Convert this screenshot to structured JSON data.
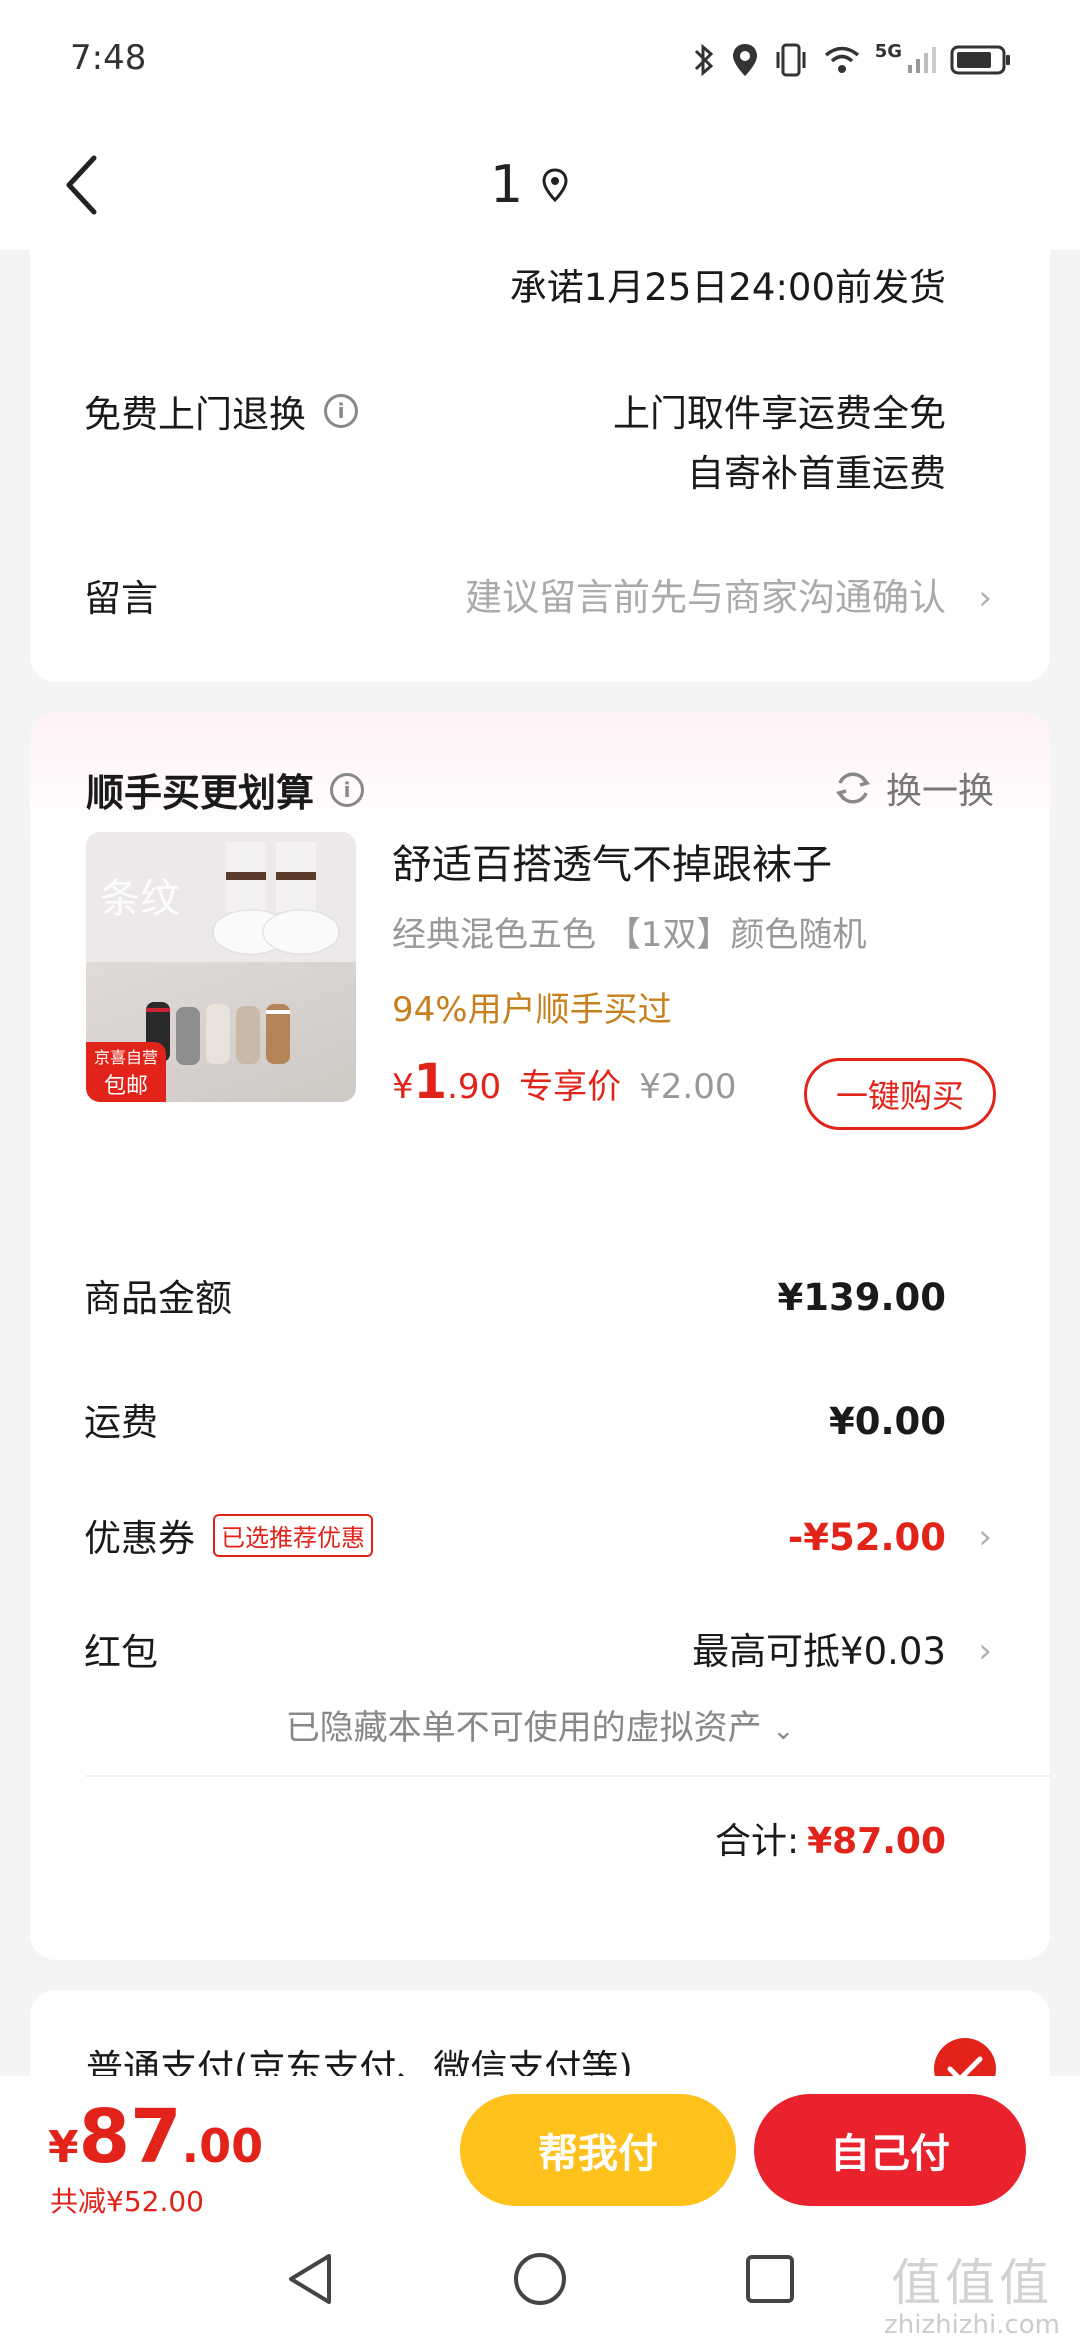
{
  "status_bar": {
    "time": "7:48",
    "network": "5G"
  },
  "nav": {
    "title": "1"
  },
  "delivery_card": {
    "promise": "承诺1月25日24:00前发货",
    "return_label": "免费上门退换",
    "return_line1": "上门取件享运费全免",
    "return_line2": "自寄补首重运费",
    "note_label": "留言",
    "note_placeholder": "建议留言前先与商家沟通确认"
  },
  "upsell": {
    "title": "顺手买更划算",
    "swap_label": "换一换",
    "product_name": "舒适百搭透气不掉跟袜子",
    "spec": "经典混色五色 【1双】颜色随机",
    "bought": "94%用户顺手买过",
    "price_symbol": "¥",
    "price_int": "1",
    "price_dec": ".90",
    "price_tag": "专享价",
    "original_price": "¥2.00",
    "buy_label": "一键购买",
    "thumb_text": "条纹",
    "thumb_badge1": "京喜自营",
    "thumb_badge2": "包邮"
  },
  "amount": {
    "goods_label": "商品金额",
    "goods_value": "¥139.00",
    "freight_label": "运费",
    "freight_value": "¥0.00",
    "coupon_label": "优惠券",
    "coupon_tag": "已选推荐优惠",
    "coupon_value": "-¥52.00",
    "redpack_label": "红包",
    "redpack_value": "最高可抵¥0.03",
    "hidden_assets": "已隐藏本单不可使用的虚拟资产",
    "total_label": "合计:",
    "total_value": "¥87.00"
  },
  "payment": {
    "label": "普通支付(京东支付、微信支付等)"
  },
  "bottom": {
    "sym": "¥",
    "int": "87",
    "dec": ".00",
    "saved": "共减¥52.00",
    "help_pay": "帮我付",
    "self_pay": "自己付"
  },
  "watermark": {
    "top": "值值值",
    "bottom": "zhizhizhi.com"
  },
  "colors": {
    "accent_red": "#e2231a",
    "help_yellow": "#ffc21c",
    "bought_gold": "#c7801e"
  }
}
